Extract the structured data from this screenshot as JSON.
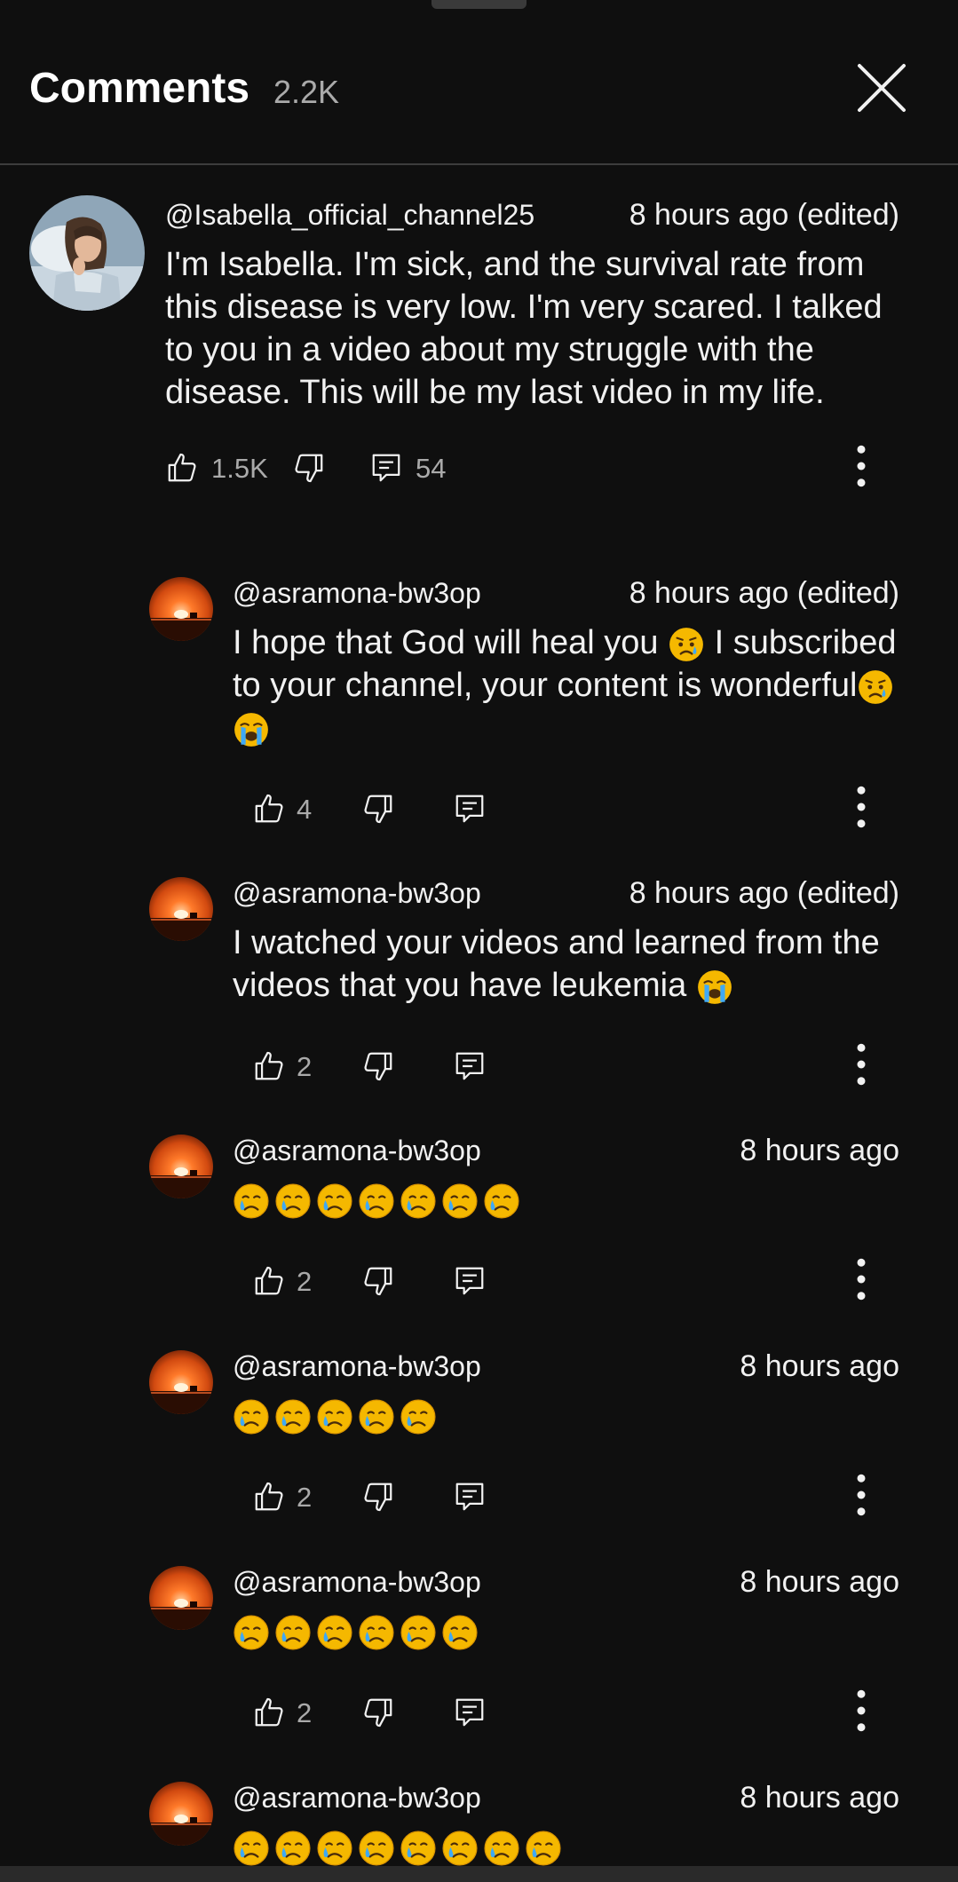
{
  "header": {
    "title": "Comments",
    "count": "2.2K"
  },
  "colors": {
    "background": "#0f0f0f",
    "text": "#f1f1f1",
    "muted": "#aaaaaa",
    "divider": "#3d3d3d"
  },
  "main_comment": {
    "username": "@Isabella_official_channel25",
    "time": "8 hours ago (edited)",
    "text": "I'm Isabella. I'm sick, and the survival rate from this disease is very low. I'm very scared. I talked to you in a video about my struggle with the disease. This will be my last video in my life.",
    "likes": "1.5K",
    "replies": "54",
    "avatar": "girl-in-hospital-bed-avatar"
  },
  "replies": [
    {
      "username": "@asramona-bw3op",
      "time": "8 hours ago (edited)",
      "text_part1": "I hope that God will heal you",
      "text_part2": "I subscribed to your channel, your content is wonderful",
      "likes": "4",
      "avatar": "sunset-avatar"
    },
    {
      "username": "@asramona-bw3op",
      "time": "8 hours ago (edited)",
      "text": "I watched your videos and learned from the videos that you have leukemia",
      "likes": "2",
      "avatar": "sunset-avatar"
    },
    {
      "username": "@asramona-bw3op",
      "time": "8 hours ago",
      "emoji_count": 7,
      "emoji": "crying-face",
      "likes": "2",
      "avatar": "sunset-avatar"
    },
    {
      "username": "@asramona-bw3op",
      "time": "8 hours ago",
      "emoji_count": 5,
      "emoji": "crying-face",
      "likes": "2",
      "avatar": "sunset-avatar"
    },
    {
      "username": "@asramona-bw3op",
      "time": "8 hours ago",
      "emoji_count": 6,
      "emoji": "crying-face",
      "likes": "2",
      "avatar": "sunset-avatar"
    },
    {
      "username": "@asramona-bw3op",
      "time": "8 hours ago",
      "emoji_count": 8,
      "emoji": "crying-face",
      "likes": "",
      "avatar": "sunset-avatar"
    }
  ]
}
